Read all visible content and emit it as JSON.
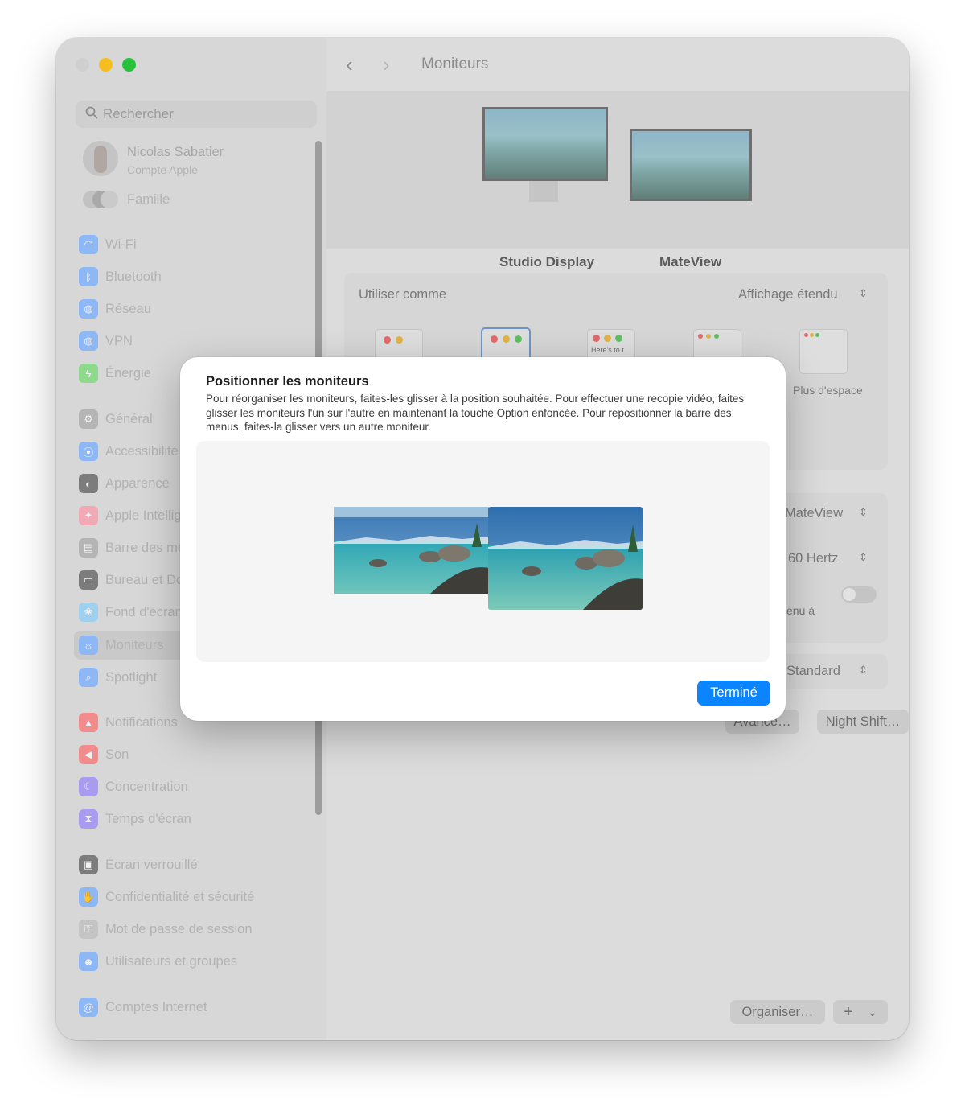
{
  "window": {
    "title": "Moniteurs"
  },
  "sidebar": {
    "search_placeholder": "Rechercher",
    "account": {
      "name": "Nicolas Sabatier",
      "subtitle": "Compte Apple"
    },
    "family_label": "Famille",
    "items": [
      {
        "label": "Wi-Fi",
        "icon": "wifi-icon",
        "color": "#8db8f5"
      },
      {
        "label": "Bluetooth",
        "icon": "bluetooth-icon",
        "color": "#8db8f5"
      },
      {
        "label": "Réseau",
        "icon": "globe-icon",
        "color": "#8db8f5"
      },
      {
        "label": "VPN",
        "icon": "vpn-icon",
        "color": "#8db8f5"
      },
      {
        "label": "Énergie",
        "icon": "battery-icon",
        "color": "#8fd98d"
      },
      {
        "label": "Général",
        "icon": "gear-icon",
        "color": "#b5b5b5"
      },
      {
        "label": "Accessibilité",
        "icon": "accessibility-icon",
        "color": "#8db8f5"
      },
      {
        "label": "Apparence",
        "icon": "appearance-icon",
        "color": "#7c7c7c"
      },
      {
        "label": "Apple Intelligence et Siri",
        "icon": "siri-icon",
        "color": "#f0a9b5"
      },
      {
        "label": "Barre des menus",
        "icon": "menubar-icon",
        "color": "#b5b5b5"
      },
      {
        "label": "Bureau et Dock",
        "icon": "dock-icon",
        "color": "#7c7c7c"
      },
      {
        "label": "Fond d'écran",
        "icon": "wallpaper-icon",
        "color": "#9ed0ef"
      },
      {
        "label": "Moniteurs",
        "icon": "sun-icon",
        "color": "#8db8f5"
      },
      {
        "label": "Spotlight",
        "icon": "spotlight-icon",
        "color": "#8db8f5"
      },
      {
        "label": "Notifications",
        "icon": "bell-icon",
        "color": "#f28b8b"
      },
      {
        "label": "Son",
        "icon": "speaker-icon",
        "color": "#f28b8b"
      },
      {
        "label": "Concentration",
        "icon": "moon-icon",
        "color": "#a99bf0"
      },
      {
        "label": "Temps d'écran",
        "icon": "hourglass-icon",
        "color": "#a99bf0"
      },
      {
        "label": "Écran verrouillé",
        "icon": "lock-icon",
        "color": "#7c7c7c"
      },
      {
        "label": "Confidentialité et sécurité",
        "icon": "hand-icon",
        "color": "#8db8f5"
      },
      {
        "label": "Mot de passe de session",
        "icon": "key-icon",
        "color": "#c4c4c4"
      },
      {
        "label": "Utilisateurs et groupes",
        "icon": "users-icon",
        "color": "#8db8f5"
      },
      {
        "label": "Comptes Internet",
        "icon": "at-icon",
        "color": "#8db8f5"
      }
    ]
  },
  "displays": [
    {
      "name": "Studio Display"
    },
    {
      "name": "MateView"
    }
  ],
  "settings": {
    "use_as_label": "Utiliser comme",
    "use_as_value": "Affichage étendu",
    "more_space_label": "Plus d'espace",
    "mini_text": "Here's to t",
    "main_display_value": "MateView",
    "refresh_value": "60 Hertz",
    "menu_text": "enu à",
    "standard_value": "Standard",
    "advanced_button": "Avancé…",
    "night_shift_button": "Night Shift…",
    "help_button": "?",
    "organize_button": "Organiser…",
    "add_button": "+",
    "dropdown_button": "⌄"
  },
  "modal": {
    "title": "Positionner les moniteurs",
    "description": "Pour réorganiser les moniteurs, faites-les glisser à la position souhaitée. Pour effectuer une recopie vidéo, faites glisser les moniteurs l'un sur l'autre en maintenant la touche Option enfoncée. Pour repositionner la barre des menus, faites-la glisser vers un autre moniteur.",
    "done_button": "Terminé"
  },
  "colors": {
    "accent": "#0a84ff",
    "traffic_min": "#f6bd1e",
    "traffic_max": "#27c13b"
  }
}
